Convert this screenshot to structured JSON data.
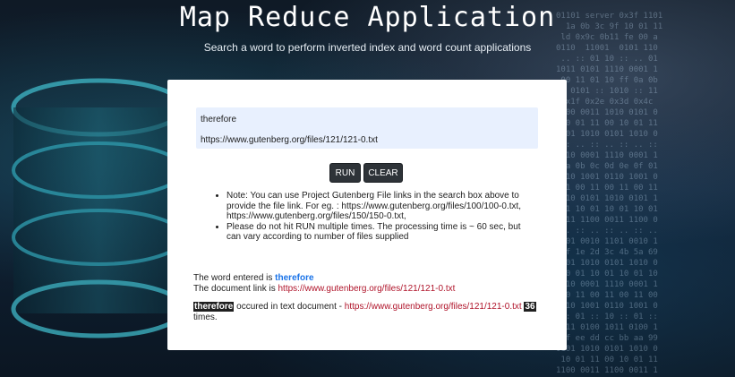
{
  "header": {
    "title": "Map Reduce Application",
    "subtitle": "Search a word to perform inverted index and word count applications"
  },
  "form": {
    "word_value": "therefore",
    "link_value": "https://www.gutenberg.org/files/121/121-0.txt",
    "run_label": "RUN",
    "clear_label": "CLEAR"
  },
  "notes": [
    "Note: You can use Project Gutenberg File links in the search box above to provide the file link. For eg. : https://www.gutenberg.org/files/100/100-0.txt, https://www.gutenberg.org/files/150/150-0.txt,",
    "Please do not hit RUN multiple times. The processing time is ~ 60 sec, but can vary according to number of files supplied"
  ],
  "result": {
    "word_prefix": "The word entered is ",
    "word": "therefore",
    "doc_prefix": "The document link is ",
    "doc_link": "https://www.gutenberg.org/files/121/121-0.txt",
    "count_word": "therefore",
    "count_middle": " occured in text document - ",
    "count_link": "https://www.gutenberg.org/files/121/121-0.txt",
    "count": "36",
    "count_suffix": "times."
  },
  "colors": {
    "accent_blue": "#1a73e8",
    "link_red": "#b0152b",
    "button_dark": "#2e3338",
    "input_bg": "#e8f0fe"
  }
}
